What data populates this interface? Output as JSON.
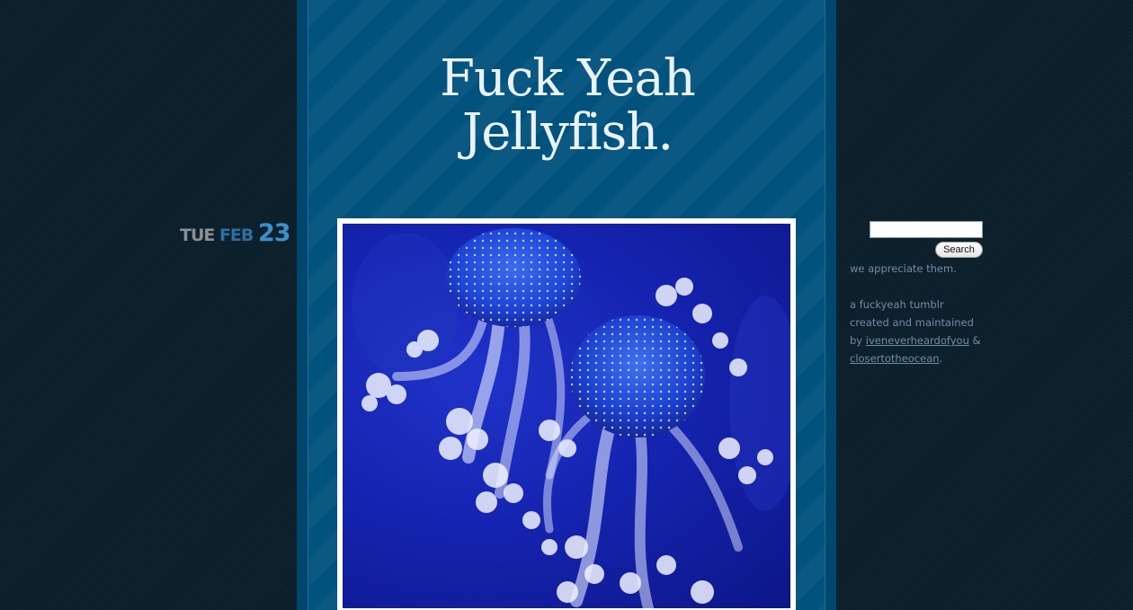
{
  "blog": {
    "title_line1": "Fuck Yeah",
    "title_line2": "Jellyfish."
  },
  "post": {
    "date_dow": "TUE",
    "date_month": "FEB",
    "date_day": "23"
  },
  "sidebar": {
    "search_button": "Search",
    "search_value": "",
    "tagline": "we appreciate them.",
    "about_line1": "a fuckyeah tumblr",
    "about_line2": "created and maintained",
    "about_by": "by",
    "link1": "iveneverheardofyou",
    "amp": "&",
    "link2": "closertotheocean",
    "period": "."
  },
  "colors": {
    "page_bg": "#0b1f2b",
    "column_bg": "#02527e",
    "title_text": "#e9f2f5",
    "sidebar_text": "#6f8ea3",
    "date_day": "#3b8fcc"
  }
}
